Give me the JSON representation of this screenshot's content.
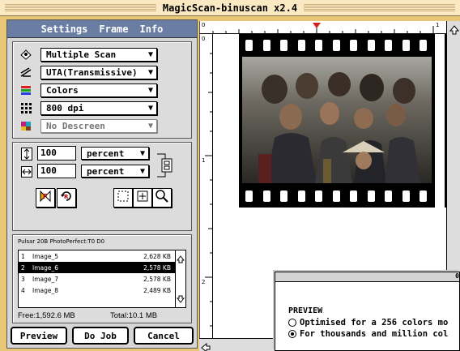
{
  "window": {
    "title": "MagicScan-binuscan x2.4"
  },
  "menu": {
    "items": [
      "Settings",
      "Frame",
      "Info"
    ]
  },
  "scan_options": [
    {
      "icon": "scanner-icon",
      "value": "Multiple Scan",
      "enabled": true
    },
    {
      "icon": "transmissive-icon",
      "value": "UTA(Transmissive)",
      "enabled": true
    },
    {
      "icon": "color-mode-icon",
      "value": "Colors",
      "enabled": true
    },
    {
      "icon": "resolution-icon",
      "value": "800 dpi",
      "enabled": true
    },
    {
      "icon": "descreen-icon",
      "value": "No Descreen",
      "enabled": false
    }
  ],
  "scale": {
    "height": {
      "value": "100",
      "unit": "percent"
    },
    "width": {
      "value": "100",
      "unit": "percent"
    }
  },
  "job_list": {
    "scanner": "Pulsar 20B PhotoPerfect:T0 D0",
    "items": [
      {
        "num": "1",
        "name": "Image_5",
        "size": "2,628 KB",
        "selected": false
      },
      {
        "num": "2",
        "name": "Image_6",
        "size": "2,578 KB",
        "selected": true
      },
      {
        "num": "3",
        "name": "Image_7",
        "size": "2,578 KB",
        "selected": false
      },
      {
        "num": "4",
        "name": "Image_8",
        "size": "2,489 KB",
        "selected": false
      }
    ],
    "free": "Free:1,592.6 MB",
    "total": "Total:10.1 MB"
  },
  "buttons": {
    "preview": "Preview",
    "do_job": "Do Job",
    "cancel": "Cancel"
  },
  "ruler": {
    "h_labels": [
      "0",
      "1"
    ],
    "v_labels": [
      "0",
      "1",
      "2"
    ]
  },
  "dialog": {
    "title_fragment": "0",
    "heading": "PREVIEW",
    "options": [
      {
        "label": "Optimised for a 256 colors mo",
        "selected": false
      },
      {
        "label": "For thousands and million col",
        "selected": true
      }
    ]
  }
}
